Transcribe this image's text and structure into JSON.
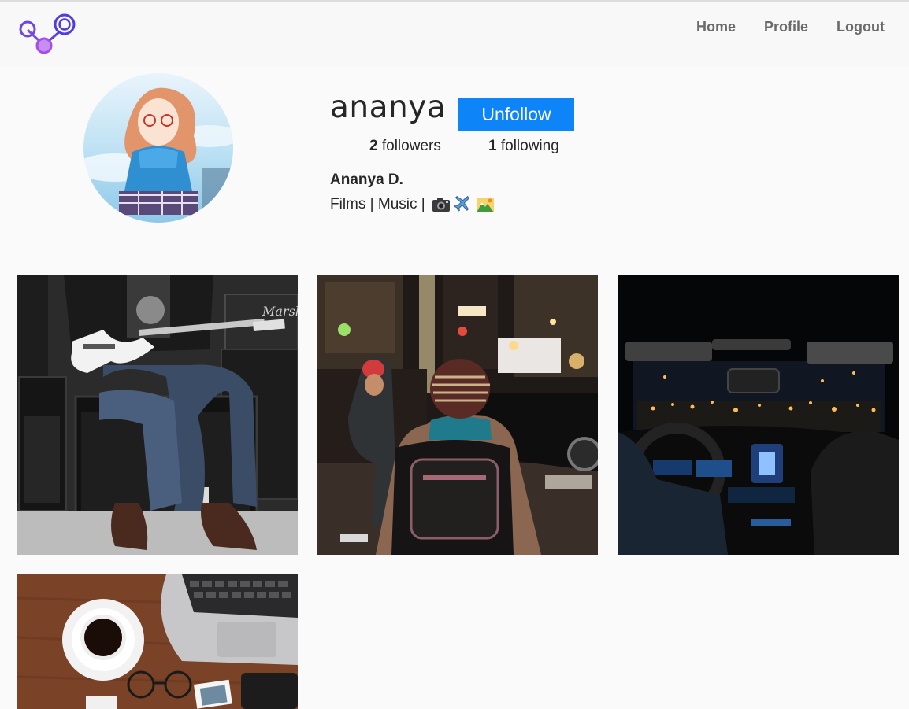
{
  "nav": {
    "home": "Home",
    "profile": "Profile",
    "logout": "Logout"
  },
  "profile": {
    "username": "ananya",
    "follow_button": "Unfollow",
    "followers_count": "2",
    "followers_label": "followers",
    "following_count": "1",
    "following_label": "following",
    "full_name": "Ananya D.",
    "bio_text": "Films | Music |",
    "bio_icons": [
      "camera-icon",
      "airplane-icon",
      "mountain-icon"
    ]
  },
  "posts": [
    {
      "name": "post-guitar"
    },
    {
      "name": "post-city-street"
    },
    {
      "name": "post-car-night"
    },
    {
      "name": "post-coffee-desk"
    }
  ],
  "colors": {
    "accent": "#0d84f8",
    "logo_primary": "#4f3de0",
    "logo_secondary": "#a54de8",
    "nav_text": "#6b6b6b"
  }
}
